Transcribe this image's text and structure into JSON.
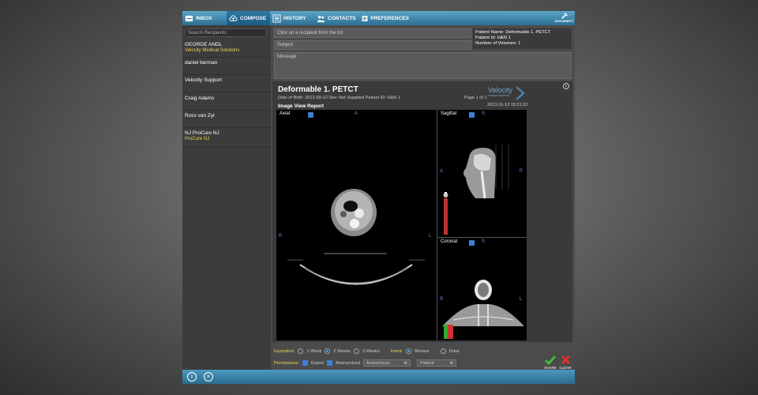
{
  "nav": {
    "inbox": "INBOX",
    "compose": "COMPOSE",
    "history": "HISTORY",
    "contacts": "CONTACTS",
    "preferences": "PREFERENCES",
    "disconnect": "DISCONNECT"
  },
  "sidebar": {
    "search_placeholder": "Search Recipients",
    "recipients": [
      {
        "name": "GEORGE ANDL",
        "org": "Velocity Medical Solutions"
      },
      {
        "name": "daniel berman",
        "org": ""
      },
      {
        "name": "Velocity Support",
        "org": ""
      },
      {
        "name": "Craig Adams",
        "org": ""
      },
      {
        "name": "Ross van Zyl",
        "org": ""
      },
      {
        "name": "NJ ProCure NJ",
        "org": "ProCure NJ"
      }
    ]
  },
  "compose": {
    "to_placeholder": "Click on a recipient from the list",
    "subject_placeholder": "Subject",
    "message_placeholder": "Message"
  },
  "patient": {
    "name_line": "Patient Name:  Deformable 1. PETCT",
    "id_line": "Patient Id:  H&N 1",
    "volumes_line": "Number of Volumes:  1"
  },
  "report": {
    "title": "Deformable  1. PETCT",
    "meta": "Date of Birth: 2012-09-12     Sex: Not Supplied     Patient ID: H&N 1",
    "subtitle": "Image View Report",
    "page": "Page 1 of 1",
    "date": "2013-11-13 15:21:22",
    "logo": "Velocity",
    "logo_sub": "medical solutions",
    "panes": {
      "axial": {
        "label": "Axial",
        "top": "A",
        "left": "R",
        "right": "L"
      },
      "sagittal": {
        "label": "Sagittal",
        "top": "S",
        "left": "A",
        "right": "P"
      },
      "coronal": {
        "label": "Coronal",
        "top": "S",
        "left": "R",
        "right": "L"
      }
    }
  },
  "options": {
    "expiration_label": "Expiration:",
    "expiration": [
      "1 Week",
      "2 Weeks",
      "3 Weeks"
    ],
    "expiration_selected": "2 Weeks",
    "intent_label": "Intent:",
    "intent": [
      "Review",
      "Draw"
    ],
    "intent_selected": "Review",
    "permissions_label": "Permissions:",
    "export": "Export",
    "anonymized": "Anonymized",
    "anon_select": "Anonymous",
    "patient_select": "Patient",
    "share": "SHARE",
    "clear": "CLEAR"
  },
  "colors": {
    "accent": "#2c6f92",
    "highlight": "#e8d25a"
  }
}
